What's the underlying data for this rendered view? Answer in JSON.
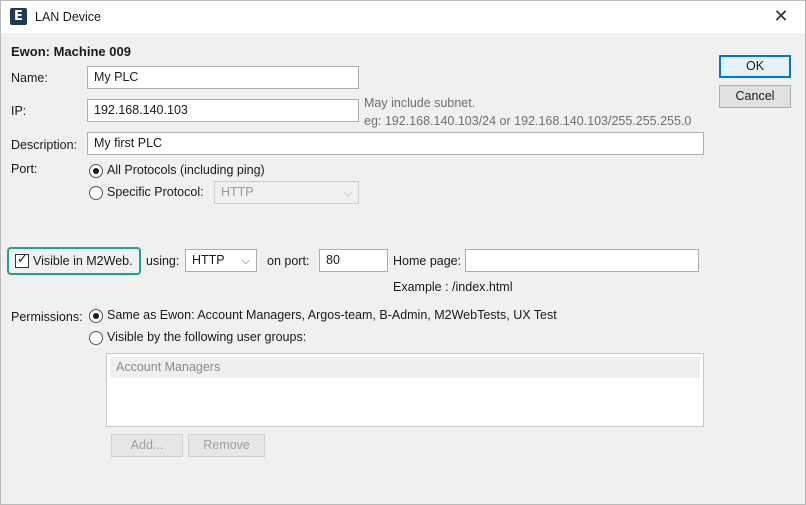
{
  "window": {
    "title": "LAN Device",
    "app_icon": "E",
    "close_glyph": "✕"
  },
  "device_heading": "Ewon: Machine 009",
  "fields": {
    "name": {
      "label": "Name:",
      "value": "My PLC"
    },
    "ip": {
      "label": "IP:",
      "value": "192.168.140.103",
      "hint_line1": "May include subnet.",
      "hint_line2": "eg: 192.168.140.103/24 or 192.168.140.103/255.255.255.0"
    },
    "description": {
      "label": "Description:",
      "value": "My first PLC"
    }
  },
  "port": {
    "label": "Port:",
    "option_all": "All Protocols (including ping)",
    "option_specific": "Specific Protocol:",
    "specific_selected": "HTTP",
    "selected": "all"
  },
  "m2web": {
    "checkbox_label": "Visible in M2Web.",
    "checked": true,
    "using_label": "using:",
    "protocol": "HTTP",
    "on_port_label": "on port:",
    "port_value": "80",
    "home_page_label": "Home page:",
    "home_page_value": "",
    "example": "Example : /index.html",
    "highlight_color": "#1ea38a"
  },
  "permissions": {
    "label": "Permissions:",
    "option_same": "Same as Ewon: Account Managers, Argos-team, B-Admin, M2WebTests, UX Test",
    "option_groups": "Visible by the following user groups:",
    "selected": "same",
    "groups": [
      "Account Managers"
    ],
    "add_label": "Add...",
    "remove_label": "Remove"
  },
  "buttons": {
    "ok": "OK",
    "cancel": "Cancel"
  },
  "icons": {
    "chevron": "⌵",
    "check": "✓"
  }
}
